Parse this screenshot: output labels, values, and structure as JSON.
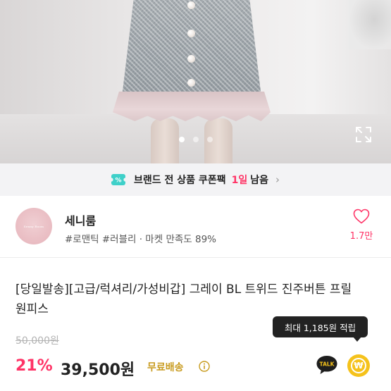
{
  "gallery": {
    "dot_count": 3,
    "active_dot": 0
  },
  "coupon": {
    "text": "브랜드 전 상품 쿠폰팩",
    "highlight": "1일",
    "rest": "남음",
    "chevron": "›",
    "accent_color": "#ff3366"
  },
  "seller": {
    "name": "세니룸",
    "tags": "#로맨틱 #러블리 · 마켓 만족도 89%",
    "avatar_text": "Senny Room",
    "like_count": "1.7만"
  },
  "product": {
    "title": "[당일발송][고급/럭셔리/가성비갑] 그레이 BL 트위드 진주버튼 프릴 원피스",
    "original_price": "50,000원",
    "discount": "21%",
    "price": "39,500원",
    "shipping": "무료배송",
    "points_tooltip": "최대 1,185원 적립"
  },
  "actions": {
    "talk_label": "TALK",
    "won_symbol": "₩"
  },
  "icons": {
    "coupon": "coupon-icon",
    "expand": "expand-icon",
    "heart": "heart-icon",
    "info": "info-icon",
    "talk": "kakaotalk-icon",
    "points": "won-coin-icon"
  }
}
